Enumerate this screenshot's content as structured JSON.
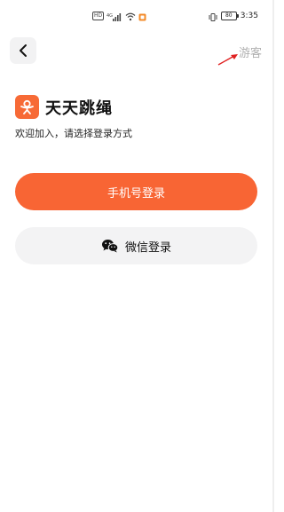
{
  "status_bar": {
    "network_badge": "HD",
    "signal_label": "4G",
    "battery_level": "80",
    "time": "3:35"
  },
  "nav": {
    "guest_label": "游客"
  },
  "brand": {
    "app_name": "天天跳绳",
    "welcome_text": "欢迎加入，请选择登录方式",
    "accent_color": "#f76a36"
  },
  "login": {
    "phone_label": "手机号登录",
    "wechat_label": "微信登录"
  }
}
